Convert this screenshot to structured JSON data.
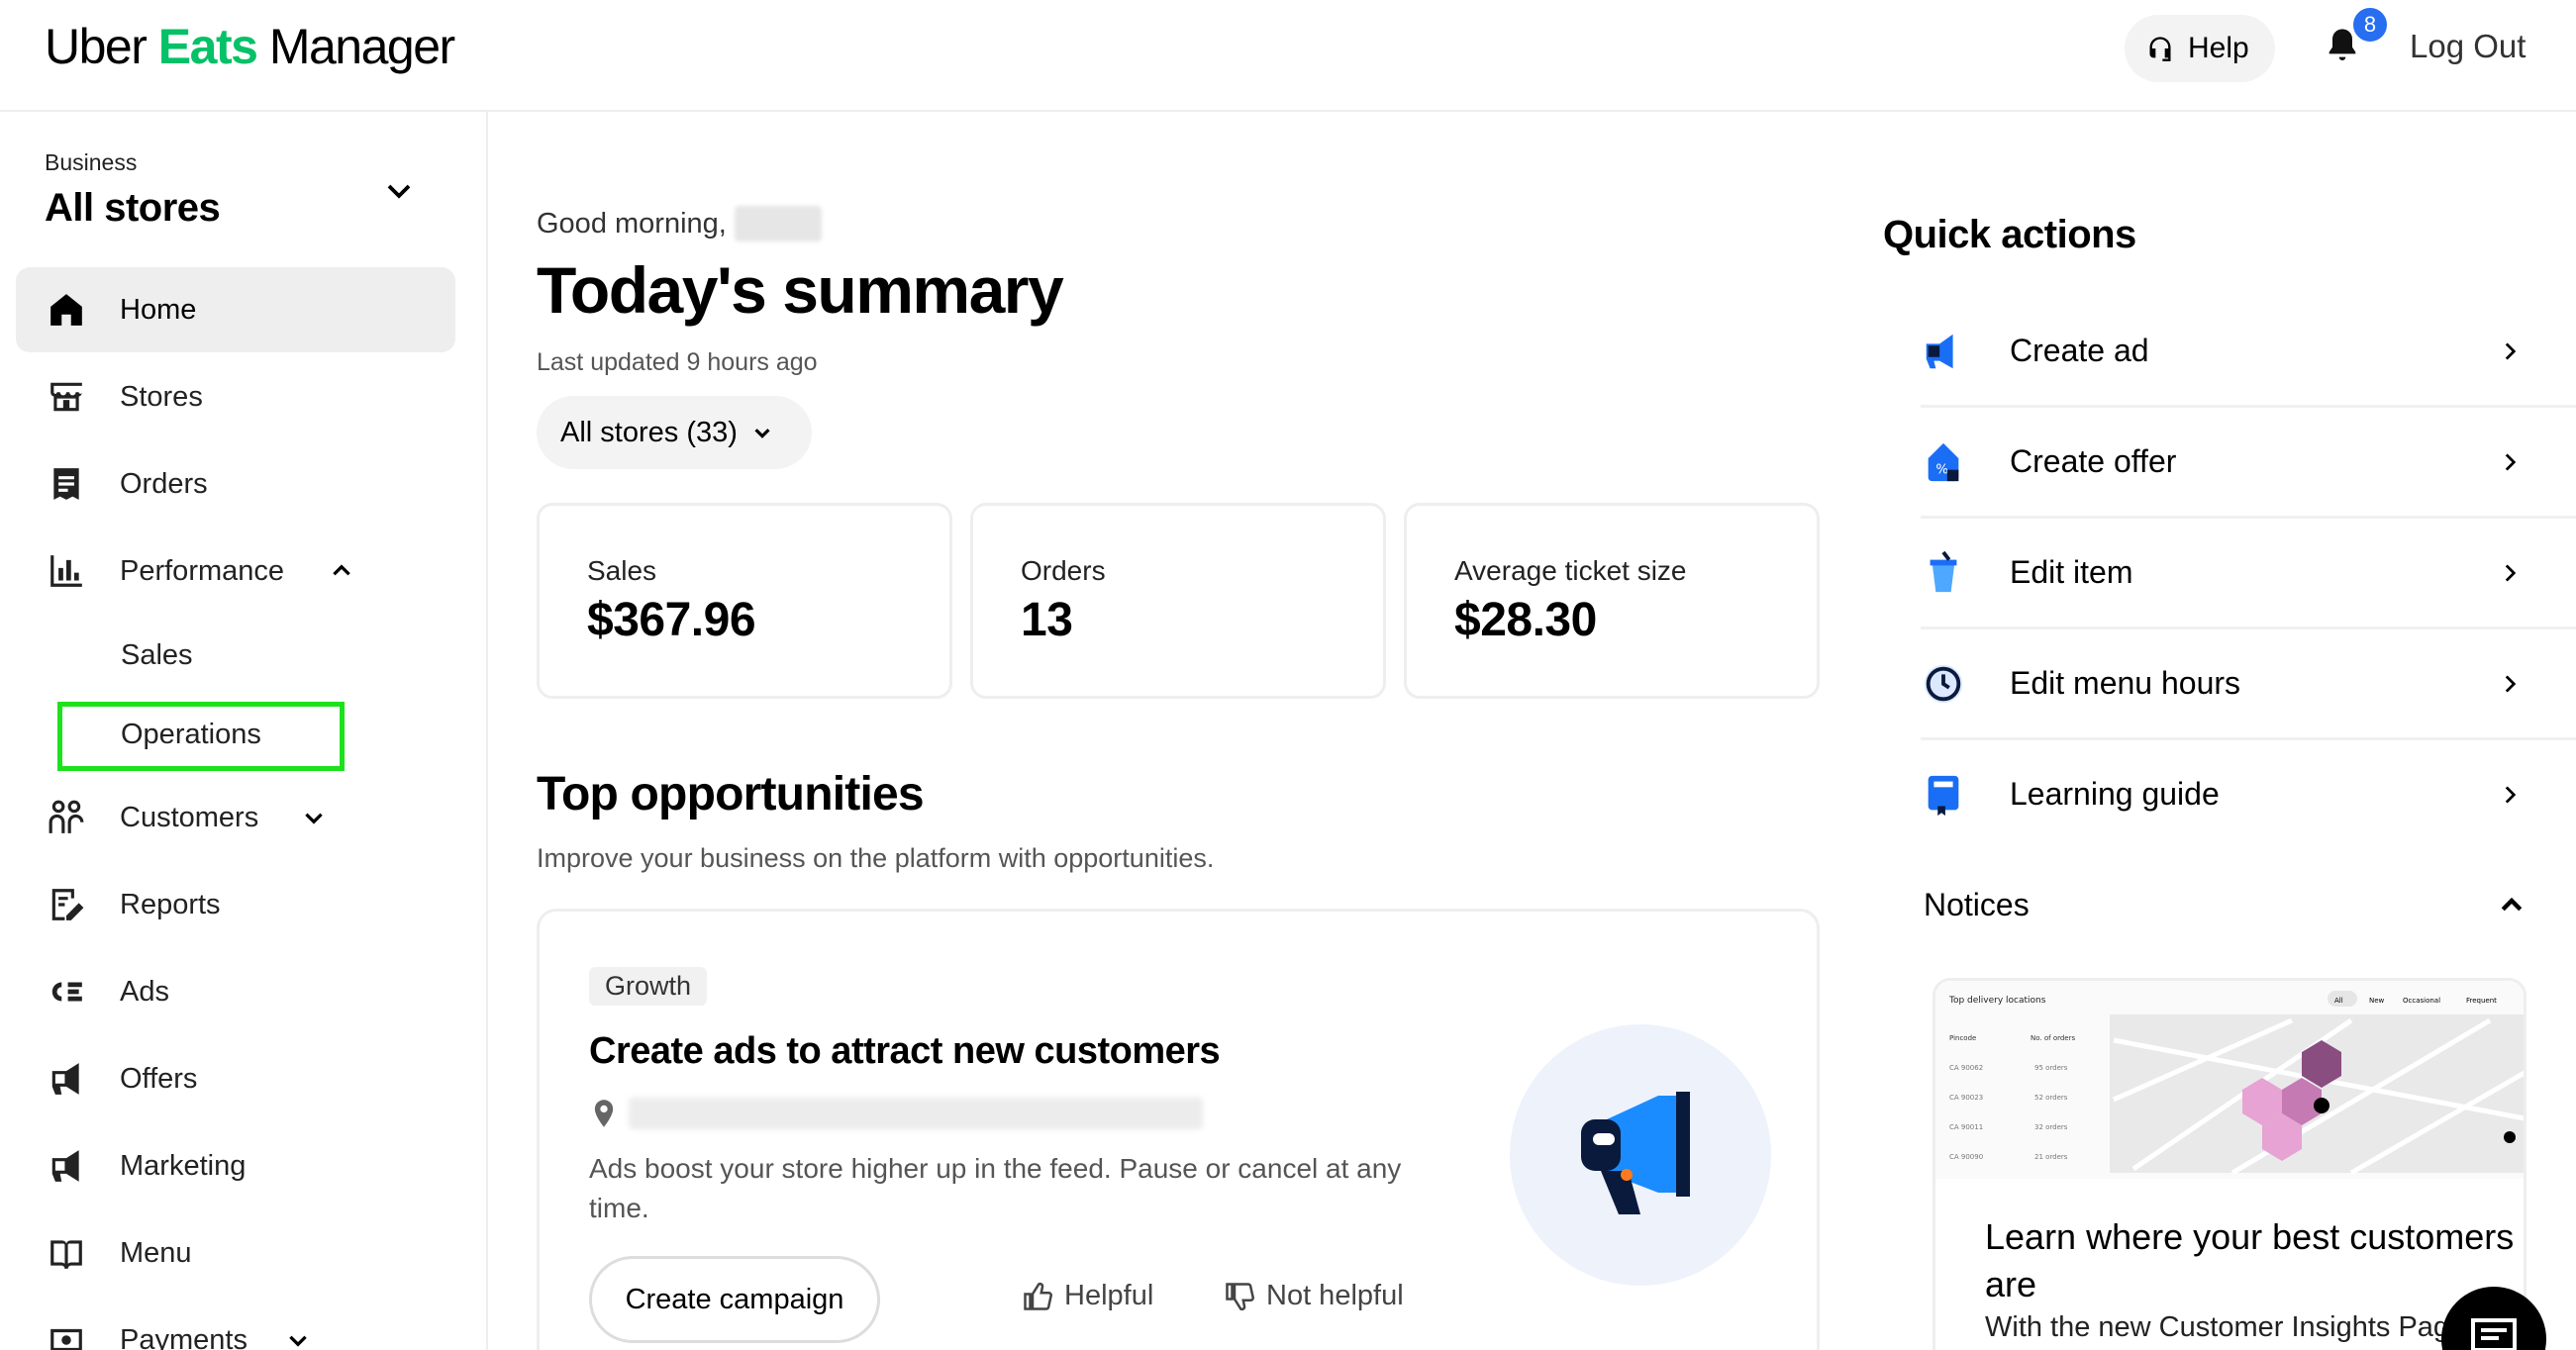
{
  "header": {
    "logo_uber": "Uber",
    "logo_eats": "Eats",
    "logo_manager": "Manager",
    "help_label": "Help",
    "notification_count": "8",
    "logout_label": "Log Out"
  },
  "sidebar": {
    "business_label": "Business",
    "business_name": "All stores",
    "items": [
      {
        "label": "Home",
        "icon": "home-icon",
        "active": true
      },
      {
        "label": "Stores",
        "icon": "store-icon"
      },
      {
        "label": "Orders",
        "icon": "receipt-icon"
      },
      {
        "label": "Performance",
        "icon": "bar-chart-icon",
        "expanded": true
      },
      {
        "label": "Customers",
        "icon": "people-icon"
      },
      {
        "label": "Reports",
        "icon": "report-icon"
      },
      {
        "label": "Ads",
        "icon": "ads-icon"
      },
      {
        "label": "Offers",
        "icon": "megaphone-icon"
      },
      {
        "label": "Marketing",
        "icon": "marketing-icon"
      },
      {
        "label": "Menu",
        "icon": "book-icon"
      },
      {
        "label": "Payments",
        "icon": "payments-icon"
      }
    ],
    "performance_sub": [
      "Sales",
      "Operations"
    ]
  },
  "main": {
    "greeting": "Good morning,",
    "title": "Today's summary",
    "last_updated": "Last updated 9 hours ago",
    "store_filter": "All stores (33)",
    "cards": [
      {
        "label": "Sales",
        "value": "$367.96"
      },
      {
        "label": "Orders",
        "value": "13"
      },
      {
        "label": "Average ticket size",
        "value": "$28.30"
      }
    ],
    "opportunities_title": "Top opportunities",
    "opportunities_subtitle": "Improve your business on the platform with opportunities.",
    "opportunity": {
      "tag": "Growth",
      "title": "Create ads to attract new customers",
      "description": "Ads boost your store higher up in the feed. Pause or cancel at any time.",
      "cta": "Create campaign",
      "helpful": "Helpful",
      "not_helpful": "Not helpful"
    }
  },
  "quick_actions": {
    "title": "Quick actions",
    "items": [
      {
        "label": "Create ad",
        "icon": "megaphone-icon"
      },
      {
        "label": "Create offer",
        "icon": "offer-tag-icon"
      },
      {
        "label": "Edit item",
        "icon": "drink-cup-icon"
      },
      {
        "label": "Edit menu hours",
        "icon": "clock-icon"
      },
      {
        "label": "Learning guide",
        "icon": "guide-book-icon"
      }
    ]
  },
  "notices": {
    "title": "Notices",
    "map_header": "Top delivery locations",
    "map_tabs": [
      "All",
      "New",
      "Occasional",
      "Frequent"
    ],
    "map_cols": [
      "Pincode",
      "No. of orders"
    ],
    "map_rows": [
      {
        "pin": "CA 90062",
        "orders": "95 orders"
      },
      {
        "pin": "CA 90023",
        "orders": "52 orders"
      },
      {
        "pin": "CA 90011",
        "orders": "32 orders"
      },
      {
        "pin": "CA 90090",
        "orders": "21 orders"
      }
    ],
    "card_title": "Learn where your best customers are",
    "card_subtitle": "With the new Customer Insights Pag"
  },
  "colors": {
    "brand_green": "#06c167",
    "badge_blue": "#276ef1",
    "highlight_green": "#1ee11e"
  }
}
